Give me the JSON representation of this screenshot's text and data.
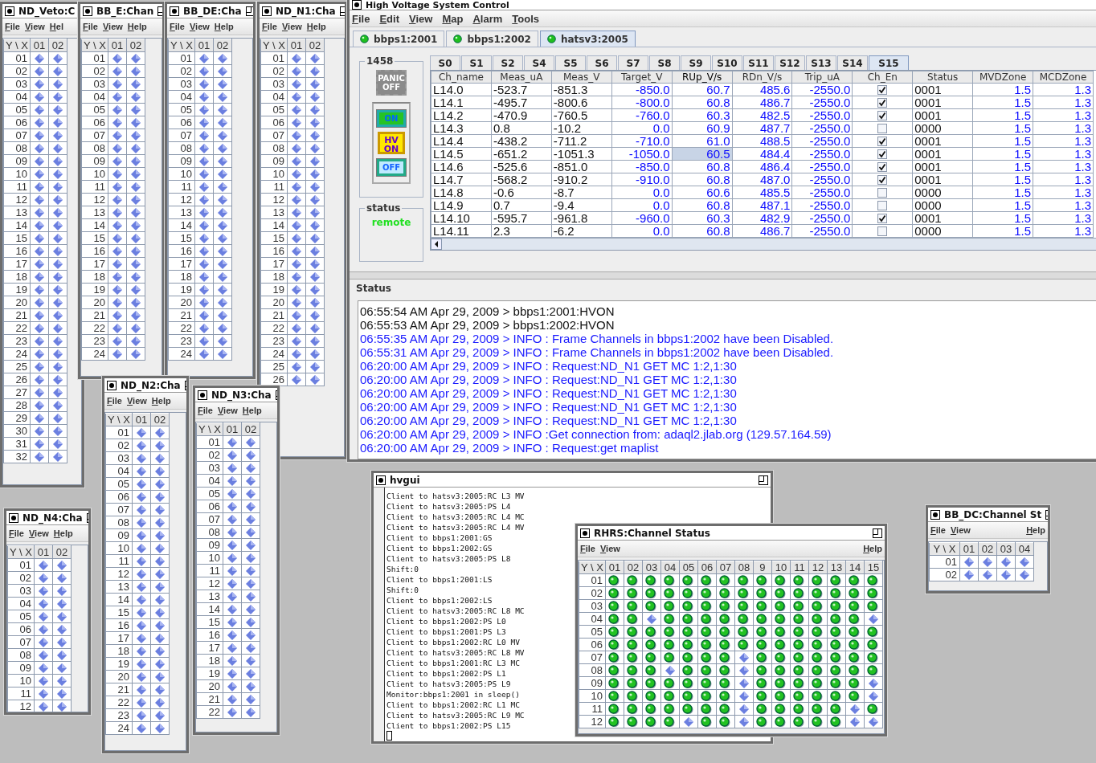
{
  "windows": [
    {
      "kind": "grid",
      "title": "ND_Veto:C",
      "maximize_button": false,
      "menus": [
        "File",
        "View",
        "Hel"
      ],
      "corner": "Y \\ X",
      "columns": [
        "01",
        "02"
      ],
      "rows": [
        {
          "label": "01",
          "on": [
            false,
            false
          ]
        },
        {
          "label": "02",
          "on": [
            false,
            false
          ]
        },
        {
          "label": "03",
          "on": [
            false,
            false
          ]
        },
        {
          "label": "04",
          "on": [
            false,
            false
          ]
        },
        {
          "label": "05",
          "on": [
            false,
            false
          ]
        },
        {
          "label": "06",
          "on": [
            false,
            false
          ]
        },
        {
          "label": "07",
          "on": [
            false,
            false
          ]
        },
        {
          "label": "08",
          "on": [
            false,
            false
          ]
        },
        {
          "label": "09",
          "on": [
            false,
            false
          ]
        },
        {
          "label": "10",
          "on": [
            false,
            false
          ]
        },
        {
          "label": "11",
          "on": [
            false,
            false
          ]
        },
        {
          "label": "12",
          "on": [
            false,
            false
          ]
        },
        {
          "label": "13",
          "on": [
            false,
            false
          ]
        },
        {
          "label": "14",
          "on": [
            false,
            false
          ]
        },
        {
          "label": "15",
          "on": [
            false,
            false
          ]
        },
        {
          "label": "16",
          "on": [
            false,
            false
          ]
        },
        {
          "label": "17",
          "on": [
            false,
            false
          ]
        },
        {
          "label": "18",
          "on": [
            false,
            false
          ]
        },
        {
          "label": "19",
          "on": [
            false,
            false
          ]
        },
        {
          "label": "20",
          "on": [
            false,
            false
          ]
        },
        {
          "label": "21",
          "on": [
            false,
            false
          ]
        },
        {
          "label": "22",
          "on": [
            false,
            false
          ]
        },
        {
          "label": "23",
          "on": [
            false,
            false
          ]
        },
        {
          "label": "24",
          "on": [
            false,
            false
          ]
        },
        {
          "label": "25",
          "on": [
            false,
            false
          ]
        },
        {
          "label": "26",
          "on": [
            false,
            false
          ]
        },
        {
          "label": "27",
          "on": [
            false,
            false
          ]
        },
        {
          "label": "28",
          "on": [
            false,
            false
          ]
        },
        {
          "label": "29",
          "on": [
            false,
            false
          ]
        },
        {
          "label": "30",
          "on": [
            false,
            false
          ]
        },
        {
          "label": "31",
          "on": [
            false,
            false
          ]
        },
        {
          "label": "32",
          "on": [
            false,
            false
          ]
        }
      ]
    },
    {
      "kind": "grid",
      "title": "BB_E:Chan",
      "maximize_button": true,
      "menus": [
        "File",
        "View",
        "Help"
      ],
      "corner": "Y \\ X",
      "columns": [
        "01",
        "02"
      ],
      "rows": [
        {
          "label": "01",
          "on": [
            false,
            false
          ]
        },
        {
          "label": "02",
          "on": [
            false,
            false
          ]
        },
        {
          "label": "03",
          "on": [
            false,
            false
          ]
        },
        {
          "label": "04",
          "on": [
            false,
            false
          ]
        },
        {
          "label": "05",
          "on": [
            false,
            false
          ]
        },
        {
          "label": "06",
          "on": [
            false,
            false
          ]
        },
        {
          "label": "07",
          "on": [
            false,
            false
          ]
        },
        {
          "label": "08",
          "on": [
            false,
            false
          ]
        },
        {
          "label": "09",
          "on": [
            false,
            false
          ]
        },
        {
          "label": "10",
          "on": [
            false,
            false
          ]
        },
        {
          "label": "11",
          "on": [
            false,
            false
          ]
        },
        {
          "label": "12",
          "on": [
            false,
            false
          ]
        },
        {
          "label": "13",
          "on": [
            false,
            false
          ]
        },
        {
          "label": "14",
          "on": [
            false,
            false
          ]
        },
        {
          "label": "15",
          "on": [
            false,
            false
          ]
        },
        {
          "label": "16",
          "on": [
            false,
            false
          ]
        },
        {
          "label": "17",
          "on": [
            false,
            false
          ]
        },
        {
          "label": "18",
          "on": [
            false,
            false
          ]
        },
        {
          "label": "19",
          "on": [
            false,
            false
          ]
        },
        {
          "label": "20",
          "on": [
            false,
            false
          ]
        },
        {
          "label": "21",
          "on": [
            false,
            false
          ]
        },
        {
          "label": "22",
          "on": [
            false,
            false
          ]
        },
        {
          "label": "23",
          "on": [
            false,
            false
          ]
        },
        {
          "label": "24",
          "on": [
            false,
            false
          ]
        }
      ]
    },
    {
      "kind": "grid",
      "title": "BB_DE:Cha",
      "maximize_button": true,
      "menus": [
        "File",
        "View",
        "Help"
      ],
      "corner": "Y \\ X",
      "columns": [
        "01",
        "02"
      ],
      "rows": [
        {
          "label": "01",
          "on": [
            false,
            false
          ]
        },
        {
          "label": "02",
          "on": [
            false,
            false
          ]
        },
        {
          "label": "03",
          "on": [
            false,
            false
          ]
        },
        {
          "label": "04",
          "on": [
            false,
            false
          ]
        },
        {
          "label": "05",
          "on": [
            false,
            false
          ]
        },
        {
          "label": "06",
          "on": [
            false,
            false
          ]
        },
        {
          "label": "07",
          "on": [
            false,
            false
          ]
        },
        {
          "label": "08",
          "on": [
            false,
            false
          ]
        },
        {
          "label": "09",
          "on": [
            false,
            false
          ]
        },
        {
          "label": "10",
          "on": [
            false,
            false
          ]
        },
        {
          "label": "11",
          "on": [
            false,
            false
          ]
        },
        {
          "label": "12",
          "on": [
            false,
            false
          ]
        },
        {
          "label": "13",
          "on": [
            false,
            false
          ]
        },
        {
          "label": "14",
          "on": [
            false,
            false
          ]
        },
        {
          "label": "15",
          "on": [
            false,
            false
          ]
        },
        {
          "label": "16",
          "on": [
            false,
            false
          ]
        },
        {
          "label": "17",
          "on": [
            false,
            false
          ]
        },
        {
          "label": "18",
          "on": [
            false,
            false
          ]
        },
        {
          "label": "19",
          "on": [
            false,
            false
          ]
        },
        {
          "label": "20",
          "on": [
            false,
            false
          ]
        },
        {
          "label": "21",
          "on": [
            false,
            false
          ]
        },
        {
          "label": "22",
          "on": [
            false,
            false
          ]
        },
        {
          "label": "23",
          "on": [
            false,
            false
          ]
        },
        {
          "label": "24",
          "on": [
            false,
            false
          ]
        }
      ]
    },
    {
      "kind": "grid",
      "title": "ND_N1:Cha",
      "maximize_button": true,
      "menus": [
        "File",
        "View",
        "Help"
      ],
      "corner": "Y \\ X",
      "columns": [
        "01",
        "02"
      ],
      "rows": [
        {
          "label": "01",
          "on": [
            false,
            false
          ]
        },
        {
          "label": "02",
          "on": [
            false,
            false
          ]
        },
        {
          "label": "03",
          "on": [
            false,
            false
          ]
        },
        {
          "label": "04",
          "on": [
            false,
            false
          ]
        },
        {
          "label": "05",
          "on": [
            false,
            false
          ]
        },
        {
          "label": "06",
          "on": [
            false,
            false
          ]
        },
        {
          "label": "07",
          "on": [
            false,
            false
          ]
        },
        {
          "label": "08",
          "on": [
            false,
            false
          ]
        },
        {
          "label": "09",
          "on": [
            false,
            false
          ]
        },
        {
          "label": "10",
          "on": [
            false,
            false
          ]
        },
        {
          "label": "11",
          "on": [
            false,
            false
          ]
        },
        {
          "label": "12",
          "on": [
            false,
            false
          ]
        },
        {
          "label": "13",
          "on": [
            false,
            false
          ]
        },
        {
          "label": "14",
          "on": [
            false,
            false
          ]
        },
        {
          "label": "15",
          "on": [
            false,
            false
          ]
        },
        {
          "label": "16",
          "on": [
            false,
            false
          ]
        },
        {
          "label": "17",
          "on": [
            false,
            false
          ]
        },
        {
          "label": "18",
          "on": [
            false,
            false
          ]
        },
        {
          "label": "19",
          "on": [
            false,
            false
          ]
        },
        {
          "label": "20",
          "on": [
            false,
            false
          ]
        },
        {
          "label": "21",
          "on": [
            false,
            false
          ]
        },
        {
          "label": "22",
          "on": [
            false,
            false
          ]
        },
        {
          "label": "23",
          "on": [
            false,
            false
          ]
        },
        {
          "label": "24",
          "on": [
            false,
            false
          ]
        },
        {
          "label": "25",
          "on": [
            false,
            false
          ]
        },
        {
          "label": "26",
          "on": [
            false,
            false
          ]
        }
      ]
    },
    {
      "kind": "grid",
      "title": "ND_N2:Cha",
      "maximize_button": true,
      "menus": [
        "File",
        "View",
        "Help"
      ],
      "corner": "Y \\ X",
      "columns": [
        "01",
        "02"
      ],
      "rows": [
        {
          "label": "01",
          "on": [
            false,
            false
          ]
        },
        {
          "label": "02",
          "on": [
            false,
            false
          ]
        },
        {
          "label": "03",
          "on": [
            false,
            false
          ]
        },
        {
          "label": "04",
          "on": [
            false,
            false
          ]
        },
        {
          "label": "05",
          "on": [
            false,
            false
          ]
        },
        {
          "label": "06",
          "on": [
            false,
            false
          ]
        },
        {
          "label": "07",
          "on": [
            false,
            false
          ]
        },
        {
          "label": "08",
          "on": [
            false,
            false
          ]
        },
        {
          "label": "09",
          "on": [
            false,
            false
          ]
        },
        {
          "label": "10",
          "on": [
            false,
            false
          ]
        },
        {
          "label": "11",
          "on": [
            false,
            false
          ]
        },
        {
          "label": "12",
          "on": [
            false,
            false
          ]
        },
        {
          "label": "13",
          "on": [
            false,
            false
          ]
        },
        {
          "label": "14",
          "on": [
            false,
            false
          ]
        },
        {
          "label": "15",
          "on": [
            false,
            false
          ]
        },
        {
          "label": "16",
          "on": [
            false,
            false
          ]
        },
        {
          "label": "17",
          "on": [
            false,
            false
          ]
        },
        {
          "label": "18",
          "on": [
            false,
            false
          ]
        },
        {
          "label": "19",
          "on": [
            false,
            false
          ]
        },
        {
          "label": "20",
          "on": [
            false,
            false
          ]
        },
        {
          "label": "21",
          "on": [
            false,
            false
          ]
        },
        {
          "label": "22",
          "on": [
            false,
            false
          ]
        },
        {
          "label": "23",
          "on": [
            false,
            false
          ]
        },
        {
          "label": "24",
          "on": [
            false,
            false
          ]
        }
      ]
    },
    {
      "kind": "grid",
      "title": "ND_N3:Cha",
      "maximize_button": true,
      "menus": [
        "File",
        "View",
        "Help"
      ],
      "corner": "Y \\ X",
      "columns": [
        "01",
        "02"
      ],
      "rows": [
        {
          "label": "01",
          "on": [
            false,
            false
          ]
        },
        {
          "label": "02",
          "on": [
            false,
            false
          ]
        },
        {
          "label": "03",
          "on": [
            false,
            false
          ]
        },
        {
          "label": "04",
          "on": [
            false,
            false
          ]
        },
        {
          "label": "05",
          "on": [
            false,
            false
          ]
        },
        {
          "label": "06",
          "on": [
            false,
            false
          ]
        },
        {
          "label": "07",
          "on": [
            false,
            false
          ]
        },
        {
          "label": "08",
          "on": [
            false,
            false
          ]
        },
        {
          "label": "09",
          "on": [
            false,
            false
          ]
        },
        {
          "label": "10",
          "on": [
            false,
            false
          ]
        },
        {
          "label": "11",
          "on": [
            false,
            false
          ]
        },
        {
          "label": "12",
          "on": [
            false,
            false
          ]
        },
        {
          "label": "13",
          "on": [
            false,
            false
          ]
        },
        {
          "label": "14",
          "on": [
            false,
            false
          ]
        },
        {
          "label": "15",
          "on": [
            false,
            false
          ]
        },
        {
          "label": "16",
          "on": [
            false,
            false
          ]
        },
        {
          "label": "17",
          "on": [
            false,
            false
          ]
        },
        {
          "label": "18",
          "on": [
            false,
            false
          ]
        },
        {
          "label": "19",
          "on": [
            false,
            false
          ]
        },
        {
          "label": "20",
          "on": [
            false,
            false
          ]
        },
        {
          "label": "21",
          "on": [
            false,
            false
          ]
        },
        {
          "label": "22",
          "on": [
            false,
            false
          ]
        }
      ]
    },
    {
      "kind": "grid",
      "title": "ND_N4:Cha",
      "maximize_button": true,
      "menus": [
        "File",
        "View",
        "Help"
      ],
      "corner": "Y \\ X",
      "columns": [
        "01",
        "02"
      ],
      "rows": [
        {
          "label": "01",
          "on": [
            false,
            false
          ]
        },
        {
          "label": "02",
          "on": [
            false,
            false
          ]
        },
        {
          "label": "03",
          "on": [
            false,
            false
          ]
        },
        {
          "label": "04",
          "on": [
            false,
            false
          ]
        },
        {
          "label": "05",
          "on": [
            false,
            false
          ]
        },
        {
          "label": "06",
          "on": [
            false,
            false
          ]
        },
        {
          "label": "07",
          "on": [
            false,
            false
          ]
        },
        {
          "label": "08",
          "on": [
            false,
            false
          ]
        },
        {
          "label": "09",
          "on": [
            false,
            false
          ]
        },
        {
          "label": "10",
          "on": [
            false,
            false
          ]
        },
        {
          "label": "11",
          "on": [
            false,
            false
          ]
        },
        {
          "label": "12",
          "on": [
            false,
            false
          ]
        }
      ]
    },
    {
      "kind": "control",
      "title": "High Voltage System Control",
      "menus": [
        "File",
        "Edit",
        "View",
        "Map",
        "Alarm",
        "Tools"
      ],
      "crates": [
        {
          "label": "bbps1:2001",
          "selected": false
        },
        {
          "label": "bbps1:2002",
          "selected": false
        },
        {
          "label": "hatsv3:2005",
          "selected": true
        }
      ],
      "crate_id": "1458",
      "buttons": [
        {
          "kind": "panic",
          "label": "PANIC OFF",
          "disabled": true
        },
        {
          "kind": "on",
          "label": "ON",
          "disabled": false
        },
        {
          "kind": "hvon",
          "label": "HV ON",
          "disabled": false
        },
        {
          "kind": "off",
          "label": "OFF",
          "disabled": false
        }
      ],
      "status_title": "status",
      "status_value": "remote",
      "slots": [
        {
          "label": "S0",
          "selected": false
        },
        {
          "label": "S1",
          "selected": false
        },
        {
          "label": "S2",
          "selected": false
        },
        {
          "label": "S4",
          "selected": false
        },
        {
          "label": "S5",
          "selected": false
        },
        {
          "label": "S6",
          "selected": false
        },
        {
          "label": "S7",
          "selected": false
        },
        {
          "label": "S8",
          "selected": false
        },
        {
          "label": "S9",
          "selected": false
        },
        {
          "label": "S10",
          "selected": false
        },
        {
          "label": "S11",
          "selected": false
        },
        {
          "label": "S12",
          "selected": false
        },
        {
          "label": "S13",
          "selected": false
        },
        {
          "label": "S14",
          "selected": false
        },
        {
          "label": "S15",
          "selected": true
        }
      ],
      "table": {
        "columns": [
          {
            "label": "Ch_name",
            "kind": "text",
            "selected": false
          },
          {
            "label": "Meas_uA",
            "kind": "text",
            "selected": false
          },
          {
            "label": "Meas_V",
            "kind": "text",
            "selected": false
          },
          {
            "label": "Target_V",
            "kind": "number",
            "selected": false
          },
          {
            "label": "RUp_V/s",
            "kind": "number",
            "selected": true
          },
          {
            "label": "RDn_V/s",
            "kind": "number",
            "selected": false
          },
          {
            "label": "Trip_uA",
            "kind": "number",
            "selected": false
          },
          {
            "label": "Ch_En",
            "kind": "check",
            "selected": false
          },
          {
            "label": "Status",
            "kind": "text",
            "selected": false
          },
          {
            "label": "MVDZone",
            "kind": "number",
            "selected": false
          },
          {
            "label": "MCDZone",
            "kind": "number",
            "selected": false
          }
        ],
        "rows": [
          {
            "cells": [
              "L14.0",
              "-523.7",
              "-851.3",
              "-850.0",
              "60.7",
              "485.6",
              "-2550.0",
              "",
              "0001",
              "1.5",
              "1.3"
            ],
            "ch_en": true,
            "selected": false
          },
          {
            "cells": [
              "L14.1",
              "-495.7",
              "-800.6",
              "-800.0",
              "60.8",
              "486.7",
              "-2550.0",
              "",
              "0001",
              "1.5",
              "1.3"
            ],
            "ch_en": true,
            "selected": false
          },
          {
            "cells": [
              "L14.2",
              "-470.9",
              "-760.5",
              "-760.0",
              "60.3",
              "482.5",
              "-2550.0",
              "",
              "0001",
              "1.5",
              "1.3"
            ],
            "ch_en": true,
            "selected": false
          },
          {
            "cells": [
              "L14.3",
              "0.8",
              "-10.2",
              "0.0",
              "60.9",
              "487.7",
              "-2550.0",
              "",
              "0000",
              "1.5",
              "1.3"
            ],
            "ch_en": false,
            "selected": false
          },
          {
            "cells": [
              "L14.4",
              "-438.2",
              "-711.2",
              "-710.0",
              "61.0",
              "488.5",
              "-2550.0",
              "",
              "0001",
              "1.5",
              "1.3"
            ],
            "ch_en": true,
            "selected": false
          },
          {
            "cells": [
              "L14.5",
              "-651.2",
              "-1051.3",
              "-1050.0",
              "60.5",
              "484.4",
              "-2550.0",
              "",
              "0001",
              "1.5",
              "1.3"
            ],
            "ch_en": true,
            "selected": true
          },
          {
            "cells": [
              "L14.6",
              "-525.6",
              "-851.0",
              "-850.0",
              "60.8",
              "486.4",
              "-2550.0",
              "",
              "0001",
              "1.5",
              "1.3"
            ],
            "ch_en": true,
            "selected": false
          },
          {
            "cells": [
              "L14.7",
              "-568.2",
              "-910.2",
              "-910.0",
              "60.8",
              "487.0",
              "-2550.0",
              "",
              "0001",
              "1.5",
              "1.3"
            ],
            "ch_en": true,
            "selected": false
          },
          {
            "cells": [
              "L14.8",
              "-0.6",
              "-8.7",
              "0.0",
              "60.6",
              "485.5",
              "-2550.0",
              "",
              "0000",
              "1.5",
              "1.3"
            ],
            "ch_en": false,
            "selected": false
          },
          {
            "cells": [
              "L14.9",
              "0.7",
              "-9.4",
              "0.0",
              "60.8",
              "487.1",
              "-2550.0",
              "",
              "0000",
              "1.5",
              "1.3"
            ],
            "ch_en": false,
            "selected": false
          },
          {
            "cells": [
              "L14.10",
              "-595.7",
              "-961.8",
              "-960.0",
              "60.3",
              "482.9",
              "-2550.0",
              "",
              "0001",
              "1.5",
              "1.3"
            ],
            "ch_en": true,
            "selected": false
          },
          {
            "cells": [
              "L14.11",
              "2.3",
              "-6.2",
              "0.0",
              "60.8",
              "486.7",
              "-2550.0",
              "",
              "0000",
              "1.5",
              "1.3"
            ],
            "ch_en": false,
            "selected": false
          }
        ]
      },
      "log_title": "Status",
      "log": [
        {
          "kind": "command",
          "text": "06:55:54 AM Apr 29, 2009 > bbps1:2001:HVON"
        },
        {
          "kind": "command",
          "text": "06:55:53 AM Apr 29, 2009 > bbps1:2002:HVON"
        },
        {
          "kind": "info",
          "text": "06:55:35 AM Apr 29, 2009 > INFO : Frame Channels in bbps1:2002 have been Disabled."
        },
        {
          "kind": "info",
          "text": "06:55:31 AM Apr 29, 2009 > INFO : Frame Channels in bbps1:2002 have been Disabled."
        },
        {
          "kind": "info",
          "text": "06:20:00 AM Apr 29, 2009 > INFO : Request:ND_N1 GET MC 1:2,1:30"
        },
        {
          "kind": "info",
          "text": "06:20:00 AM Apr 29, 2009 > INFO : Request:ND_N1 GET MC 1:2,1:30"
        },
        {
          "kind": "info",
          "text": "06:20:00 AM Apr 29, 2009 > INFO : Request:ND_N1 GET MC 1:2,1:30"
        },
        {
          "kind": "info",
          "text": "06:20:00 AM Apr 29, 2009 > INFO : Request:ND_N1 GET MC 1:2,1:30"
        },
        {
          "kind": "info",
          "text": "06:20:00 AM Apr 29, 2009 > INFO : Request:ND_N1 GET MC 1:2,1:30"
        },
        {
          "kind": "info",
          "text": "06:20:00 AM Apr 29, 2009 > INFO :Get connection from: adaql2.jlab.org (129.57.164.59)"
        },
        {
          "kind": "info",
          "text": "06:20:00 AM Apr 29, 2009 > INFO : Request:get maplist"
        }
      ]
    },
    {
      "kind": "console",
      "title": "hvgui",
      "maximize_button": true,
      "lines": [
        "Client to hatsv3:2005:RC L3 MV",
        "Client to hatsv3:2005:PS L4",
        "Client to hatsv3:2005:RC L4 MC",
        "Client to hatsv3:2005:RC L4 MV",
        "Client to bbps1:2001:GS",
        "Client to bbps1:2002:GS",
        "Client to hatsv3:2005:PS L8",
        "Shift:0",
        "Client to bbps1:2001:LS",
        "Shift:0",
        "Client to bbps1:2002:LS",
        "Client to hatsv3:2005:RC L8 MC",
        "Client to bbps1:2002:PS L0",
        "Client to bbps1:2001:PS L3",
        "Client to bbps1:2002:RC L0 MV",
        "Client to hatsv3:2005:RC L8 MV",
        "Client to bbps1:2001:RC L3 MC",
        "Client to bbps1:2002:PS L1",
        "Client to hatsv3:2005:PS L9",
        "Monitor:bbps1:2001 in sleep()",
        "Client to bbps1:2002:RC L1 MC",
        "Client to hatsv3:2005:RC L9 MC",
        "Client to bbps1:2002:PS L15"
      ]
    },
    {
      "kind": "grid",
      "title": "RHRS:Channel Status",
      "maximize_button": true,
      "menus": [
        "File",
        "View",
        "Help"
      ],
      "corner": "Y \\ X",
      "columns": [
        "01",
        "02",
        "03",
        "04",
        "05",
        "06",
        "07",
        "08",
        "9",
        "10",
        "11",
        "12",
        "13",
        "14",
        "15"
      ],
      "rows": [
        {
          "label": "01",
          "on": [
            true,
            true,
            true,
            true,
            true,
            true,
            true,
            true,
            true,
            true,
            true,
            true,
            true,
            true,
            true
          ]
        },
        {
          "label": "02",
          "on": [
            true,
            true,
            true,
            true,
            true,
            true,
            true,
            true,
            true,
            true,
            true,
            true,
            true,
            true,
            true
          ]
        },
        {
          "label": "03",
          "on": [
            true,
            true,
            true,
            true,
            true,
            true,
            true,
            true,
            true,
            true,
            true,
            true,
            true,
            true,
            true
          ]
        },
        {
          "label": "04",
          "on": [
            true,
            true,
            false,
            true,
            true,
            true,
            true,
            true,
            true,
            true,
            true,
            true,
            true,
            true,
            false
          ]
        },
        {
          "label": "05",
          "on": [
            true,
            true,
            true,
            true,
            true,
            true,
            true,
            true,
            true,
            true,
            true,
            true,
            true,
            true,
            true
          ]
        },
        {
          "label": "06",
          "on": [
            true,
            true,
            true,
            true,
            true,
            true,
            true,
            true,
            true,
            true,
            true,
            true,
            true,
            true,
            true
          ]
        },
        {
          "label": "07",
          "on": [
            true,
            true,
            true,
            true,
            true,
            true,
            true,
            false,
            true,
            true,
            true,
            true,
            true,
            true,
            true
          ]
        },
        {
          "label": "08",
          "on": [
            true,
            true,
            true,
            false,
            true,
            true,
            true,
            false,
            true,
            true,
            true,
            true,
            true,
            true,
            true
          ]
        },
        {
          "label": "09",
          "on": [
            true,
            true,
            true,
            true,
            true,
            true,
            true,
            false,
            true,
            true,
            true,
            true,
            true,
            true,
            false
          ]
        },
        {
          "label": "10",
          "on": [
            true,
            true,
            true,
            true,
            true,
            true,
            true,
            false,
            true,
            true,
            true,
            true,
            true,
            true,
            false
          ]
        },
        {
          "label": "11",
          "on": [
            true,
            true,
            true,
            true,
            true,
            true,
            true,
            false,
            true,
            true,
            true,
            true,
            true,
            false,
            true
          ]
        },
        {
          "label": "12",
          "on": [
            true,
            true,
            true,
            true,
            false,
            true,
            true,
            false,
            true,
            true,
            true,
            true,
            true,
            false,
            false
          ]
        }
      ]
    },
    {
      "kind": "grid",
      "title": "BB_DC:Channel St",
      "maximize_button": true,
      "menus": [
        "File",
        "View",
        "Help"
      ],
      "corner": "Y \\ X",
      "columns": [
        "01",
        "02",
        "03",
        "04"
      ],
      "rows": [
        {
          "label": "01",
          "on": [
            false,
            false,
            false,
            false
          ]
        },
        {
          "label": "02",
          "on": [
            false,
            false,
            false,
            false
          ]
        }
      ]
    }
  ]
}
